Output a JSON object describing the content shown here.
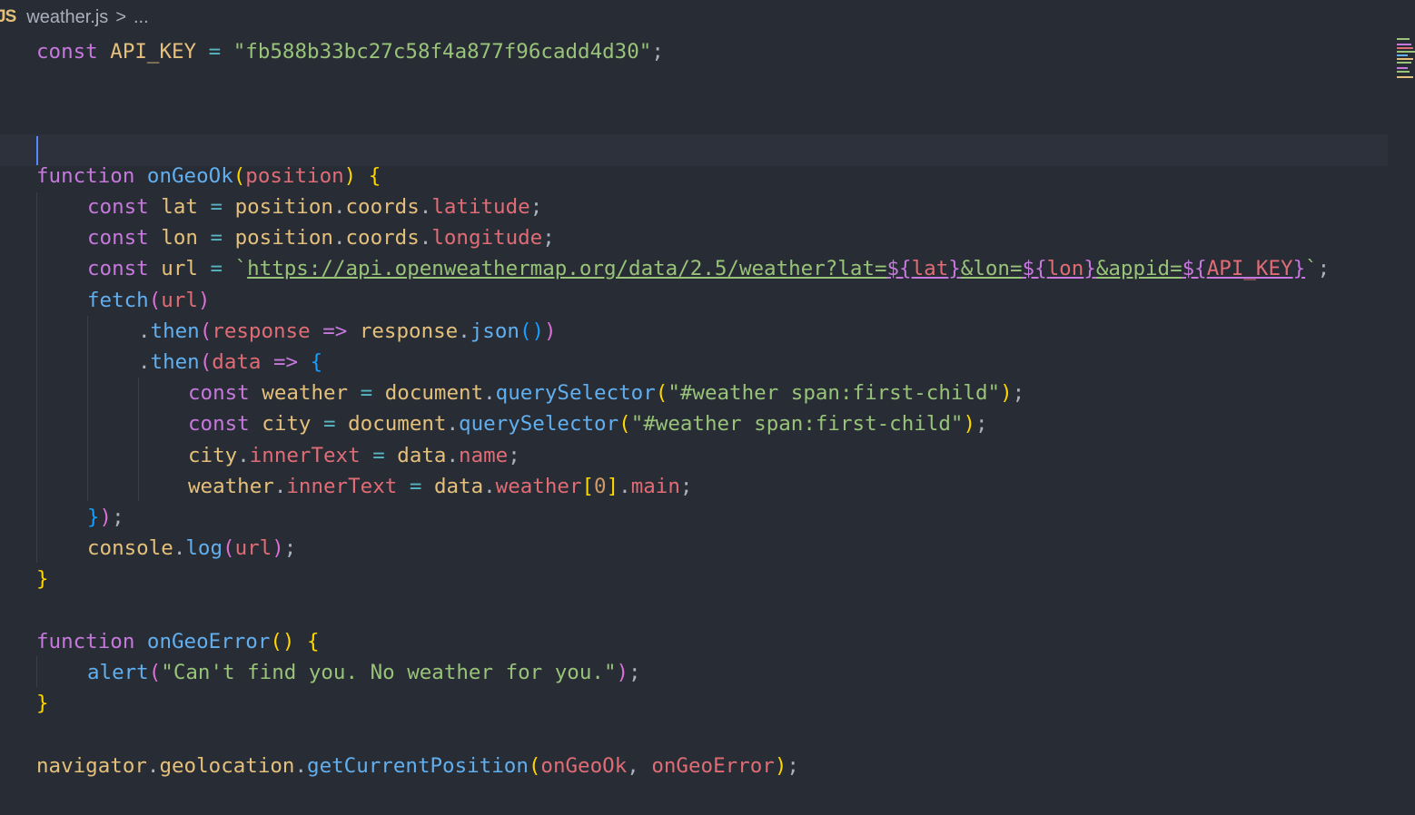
{
  "breadcrumb": {
    "file_icon": "JS",
    "file_name": "weather.js",
    "separator": ">",
    "rest": "..."
  },
  "colors": {
    "background": "#282c34",
    "keyword": "#c678dd",
    "function": "#61afef",
    "string": "#98c379",
    "variable": "#e06c75",
    "constant": "#e5c07b"
  },
  "code": {
    "l1": {
      "kw": "const",
      "name": "API_KEY",
      "eq": " = ",
      "value": "\"fb588b33bc27c58f4a877f96cadd4d30\"",
      "end": ";"
    },
    "l5": {
      "kw": "function",
      "name": "onGeoOk",
      "open": "(",
      "param": "position",
      "close": ")",
      "brace": " {"
    },
    "l6": {
      "kw": "const",
      "name": "lat",
      "eq": " = ",
      "obj": "position",
      "d1": ".",
      "p1": "coords",
      "d2": ".",
      "p2": "latitude",
      "end": ";"
    },
    "l7": {
      "kw": "const",
      "name": "lon",
      "eq": " = ",
      "obj": "position",
      "d1": ".",
      "p1": "coords",
      "d2": ".",
      "p2": "longitude",
      "end": ";"
    },
    "l8": {
      "kw": "const",
      "name": "url",
      "eq": " = ",
      "tick": "`",
      "url_a": "https://api.openweathermap.org/data/2.5/weather?lat=",
      "i1o": "${",
      "i1v": "lat",
      "i1c": "}",
      "url_b": "&lon=",
      "i2o": "${",
      "i2v": "lon",
      "i2c": "}",
      "url_c": "&appid=",
      "i3o": "${",
      "i3v": "API_KEY",
      "i3c": "}",
      "tick_end": "`",
      "end": ";"
    },
    "l9": {
      "fn": "fetch",
      "open": "(",
      "arg": "url",
      "close": ")"
    },
    "l10": {
      "dot": ".",
      "fn": "then",
      "open": "(",
      "param": "response",
      "arrow": " => ",
      "obj": "response",
      "dot2": ".",
      "fn2": "json",
      "inner": "()",
      "close": ")"
    },
    "l11": {
      "dot": ".",
      "fn": "then",
      "open": "(",
      "param": "data",
      "arrow": " => ",
      "brace": "{"
    },
    "l12": {
      "kw": "const",
      "name": "weather",
      "eq": " = ",
      "obj": "document",
      "dot": ".",
      "fn": "querySelector",
      "open": "(",
      "str": "\"#weather span:first-child\"",
      "close": ")",
      "end": ";"
    },
    "l13": {
      "kw": "const",
      "name": "city",
      "eq": " = ",
      "obj": "document",
      "dot": ".",
      "fn": "querySelector",
      "open": "(",
      "str": "\"#weather span:first-child\"",
      "close": ")",
      "end": ";"
    },
    "l14": {
      "obj": "city",
      "dot": ".",
      "prop": "innerText",
      "eq": " = ",
      "obj2": "data",
      "dot2": ".",
      "prop2": "name",
      "end": ";"
    },
    "l15": {
      "obj": "weather",
      "dot": ".",
      "prop": "innerText",
      "eq": " = ",
      "obj2": "data",
      "dot2": ".",
      "prop2": "weather",
      "bo": "[",
      "num": "0",
      "bc": "]",
      "dot3": ".",
      "prop3": "main",
      "end": ";"
    },
    "l16": {
      "brace": "}",
      "paren": ")",
      "end": ";"
    },
    "l17": {
      "obj": "console",
      "dot": ".",
      "fn": "log",
      "open": "(",
      "arg": "url",
      "close": ")",
      "end": ";"
    },
    "l18": {
      "brace": "}"
    },
    "l20": {
      "kw": "function",
      "name": "onGeoError",
      "parens": "()",
      "brace": " {"
    },
    "l21": {
      "fn": "alert",
      "open": "(",
      "str": "\"Can't find you. No weather for you.\"",
      "close": ")",
      "end": ";"
    },
    "l22": {
      "brace": "}"
    },
    "l24": {
      "obj": "navigator",
      "dot": ".",
      "obj2": "geolocation",
      "dot2": ".",
      "fn": "getCurrentPosition",
      "open": "(",
      "a1": "onGeoOk",
      "comma": ", ",
      "a2": "onGeoError",
      "close": ")",
      "end": ";"
    }
  }
}
